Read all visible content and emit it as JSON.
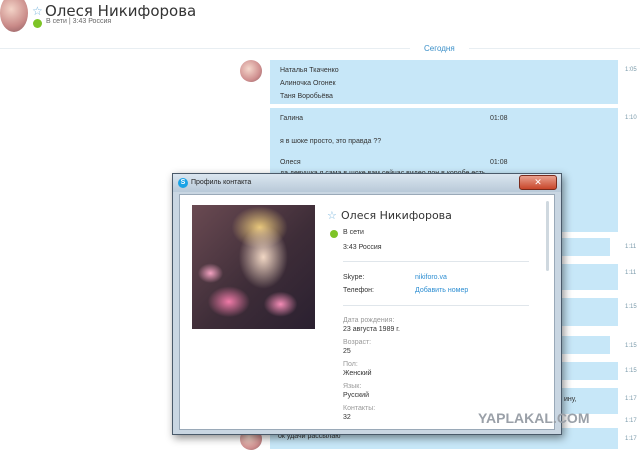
{
  "header": {
    "contact_name": "Олеся Никифорова",
    "status": "В сети",
    "separator": "|",
    "local_time": "3:43 Россия"
  },
  "day_label": "Сегодня",
  "messages": [
    {
      "lines": [
        "Наталья Ткаченко",
        "Алиночка Огонек",
        "Таня Воробьёва"
      ],
      "time": "1:05"
    },
    {
      "lines": [
        "Галина",
        "я в шоке просто, это правда ??",
        "Олеся",
        "да девушка я сама в шоке вам сейчас видео пон в коробе есть"
      ],
      "inner_times": [
        "01:08",
        "01:08"
      ],
      "time": "1:10"
    },
    {
      "lines": [],
      "time": "1:11"
    },
    {
      "lines": [],
      "time": "1:11"
    },
    {
      "lines": [],
      "time": "1:15"
    },
    {
      "lines": [],
      "time": "1:15"
    },
    {
      "lines": [],
      "time": "1:15"
    },
    {
      "lines": [
        "ину,"
      ],
      "time": "1:17"
    },
    {
      "lines": [],
      "time": "1:17"
    },
    {
      "lines": [
        "ок удачи рассылаю"
      ],
      "time": "1:17"
    }
  ],
  "dialog": {
    "title": "Профиль контакта",
    "close_label": "✕",
    "name": "Олеся Никифорова",
    "status": "В сети",
    "local_time": "3:43 Россия",
    "skype_label": "Skype:",
    "skype_value": "nikiforo.va",
    "phone_label": "Телефон:",
    "phone_action": "Добавить номер",
    "birth_label": "Дата рождения:",
    "birth_value": "23 августа 1989 г.",
    "age_label": "Возраст:",
    "age_value": "25",
    "gender_label": "Пол:",
    "gender_value": "Женский",
    "language_label": "Язык:",
    "language_value": "Русский",
    "contacts_label": "Контакты:",
    "contacts_value": "32"
  },
  "watermark": "YAPLAKAL.COM",
  "colors": {
    "bubble": "#c7e7f8",
    "online": "#7ec427",
    "link": "#2d8ed2",
    "accent": "#1aa3e6"
  }
}
